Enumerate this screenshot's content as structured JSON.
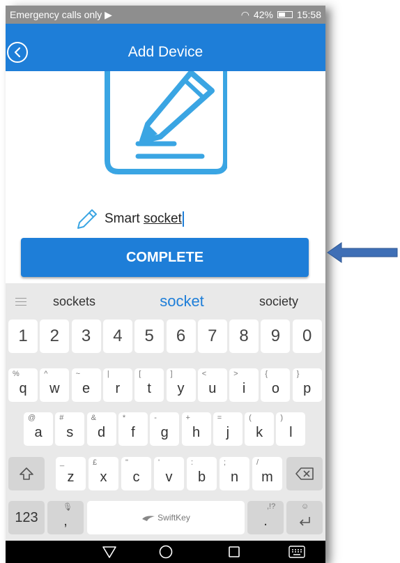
{
  "status": {
    "left": "Emergency calls only",
    "battery": "42%",
    "time": "15:58"
  },
  "appbar": {
    "title": "Add Device"
  },
  "form": {
    "name_prefix": "Smart ",
    "name_underlined": "socket"
  },
  "actions": {
    "complete": "COMPLETE"
  },
  "suggestions": [
    "sockets",
    "socket",
    "society"
  ],
  "keyboard": {
    "numbers": [
      "1",
      "2",
      "3",
      "4",
      "5",
      "6",
      "7",
      "8",
      "9",
      "0"
    ],
    "row1": [
      {
        "k": "q",
        "s": "%"
      },
      {
        "k": "w",
        "s": "^"
      },
      {
        "k": "e",
        "s": "~"
      },
      {
        "k": "r",
        "s": "|"
      },
      {
        "k": "t",
        "s": "["
      },
      {
        "k": "y",
        "s": "]"
      },
      {
        "k": "u",
        "s": "<"
      },
      {
        "k": "i",
        "s": ">"
      },
      {
        "k": "o",
        "s": "{"
      },
      {
        "k": "p",
        "s": "}"
      }
    ],
    "row2": [
      {
        "k": "a",
        "s": "@"
      },
      {
        "k": "s",
        "s": "#"
      },
      {
        "k": "d",
        "s": "&"
      },
      {
        "k": "f",
        "s": "*"
      },
      {
        "k": "g",
        "s": "-"
      },
      {
        "k": "h",
        "s": "+"
      },
      {
        "k": "j",
        "s": "="
      },
      {
        "k": "k",
        "s": "("
      },
      {
        "k": "l",
        "s": ")"
      }
    ],
    "row3": [
      {
        "k": "z",
        "s": "_"
      },
      {
        "k": "x",
        "s": "£"
      },
      {
        "k": "c",
        "s": "\""
      },
      {
        "k": "v",
        "s": "'"
      },
      {
        "k": "b",
        "s": ":"
      },
      {
        "k": "n",
        "s": ";"
      },
      {
        "k": "m",
        "s": "/"
      }
    ],
    "num_key": "123",
    "comma_key": ",",
    "space_brand": "SwiftKey",
    "period_key": ".",
    "period_sec": ",!?"
  },
  "colors": {
    "primary": "#1e7ed8",
    "icon": "#3aa5e3",
    "arrow": "#3f6fb6"
  }
}
